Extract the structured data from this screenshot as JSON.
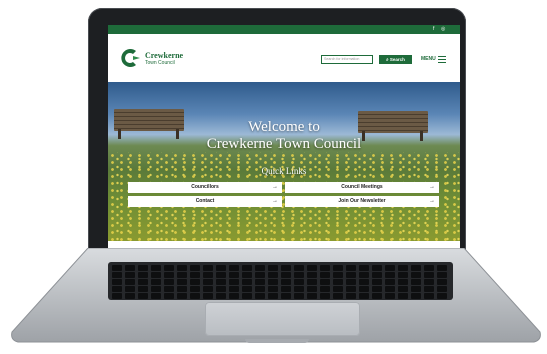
{
  "colors": {
    "brand": "#1e6b3a",
    "topbar": "#1e6b3a",
    "button_bg": "#ffffff"
  },
  "topbar": {
    "social": [
      {
        "icon": "facebook-icon",
        "glyph": "f"
      },
      {
        "icon": "instagram-icon",
        "glyph": "◎"
      }
    ]
  },
  "header": {
    "logo_name": "Crewkerne",
    "logo_sub": "Town Council",
    "search_placeholder": "Search for information",
    "search_button": "Search",
    "search_button_icon": "magnifier-icon",
    "menu_label": "MENU",
    "menu_icon": "hamburger-icon"
  },
  "hero": {
    "title_line1": "Welcome to",
    "title_line2": "Crewkerne Town Council",
    "quick_links_title": "Quick Links",
    "links": [
      {
        "label": "Councillors",
        "arrow": "→"
      },
      {
        "label": "Council Meetings",
        "arrow": "→"
      },
      {
        "label": "Contact",
        "arrow": "→"
      },
      {
        "label": "Join Our Newsletter",
        "arrow": "→"
      }
    ]
  }
}
